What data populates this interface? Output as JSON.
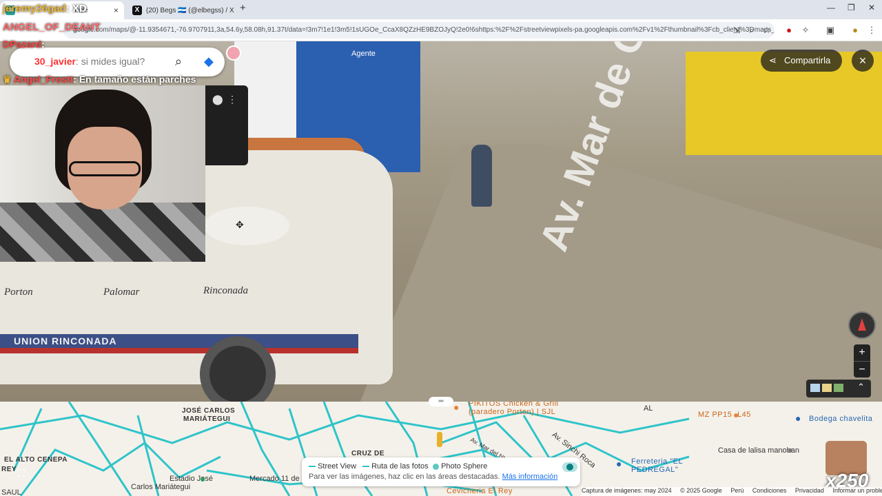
{
  "browser": {
    "tabs": [
      {
        "title": "Inde",
        "favicon": "game-icon"
      },
      {
        "title": "(20) Begs 🇳🇮 (@elbegss) / X",
        "favicon": "x-icon"
      }
    ],
    "new_tab": "+",
    "tab_close": "×",
    "url": "google.com/maps/@-11.9354671,-76.9707911,3a,54.6y,58.08h,91.37t/data=!3m7!1e1!3m5!1sUGOe_CcaX8QZzHE9BZOJyQ!2e0!6shttps:%2F%2Fstreetviewpixels-pa.googleapis.com%2Fv1%2Fthumbnail%3Fcb_client%3Dmaps_sv.tac..."
  },
  "chat": {
    "user1_name": "jeremy26gad",
    "user1_msg": ": XD",
    "user2_name": "ANGEL_OF_DEAHT",
    "user3_name": "DPazard",
    "user3_msg": ":",
    "user4_name": "30_javier",
    "user4_msg": ": si mides igual?",
    "user5_name": "Angel_Frostt",
    "user5_msg": ": En tamaño están parches"
  },
  "streetview": {
    "share_label": "Compartirla",
    "close_label": "×",
    "street_name": "Av. Mar de Coral",
    "shop_sign": "Agente",
    "van_labels": [
      "Porton",
      "Palomar",
      "Rinconada"
    ],
    "van_side": "UNION RINCONADA",
    "zoom_in": "+",
    "zoom_out": "−",
    "expand": "⌃"
  },
  "map": {
    "labels": [
      {
        "text": "JOSÉ CARLOS",
        "cls": ""
      },
      {
        "text": "MARIÁTEGUI",
        "cls": ""
      },
      {
        "text": "EL ALTO CENEPA",
        "cls": ""
      },
      {
        "text": "REY",
        "cls": ""
      },
      {
        "text": "CRUZ DE",
        "cls": ""
      },
      {
        "text": "AL",
        "cls": "n"
      },
      {
        "text": "Estadio José",
        "cls": "n"
      },
      {
        "text": "Carlos Mariátegui",
        "cls": "n"
      },
      {
        "text": "Mercado 11 de",
        "cls": "n"
      },
      {
        "text": "Casa de lalisa manoban",
        "cls": "n"
      },
      {
        "text": "Av. Sinchi Roca",
        "cls": "n"
      },
      {
        "text": "Av. Mar del Nte Este",
        "cls": "n"
      },
      {
        "text": "SAUL",
        "cls": "n"
      }
    ],
    "pois": [
      {
        "text": "PIKITOS Chicken & Grill",
        "cls": "o"
      },
      {
        "text": "(paradero Porton) | SJL",
        "cls": "o"
      },
      {
        "text": "MZ PP15 -L45",
        "cls": "o"
      },
      {
        "text": "Bodega chavelita",
        "cls": "b"
      },
      {
        "text": "Ferreteria \"EL",
        "cls": "b"
      },
      {
        "text": "PEDREGAL\"",
        "cls": "b"
      },
      {
        "text": "Cevicheria El Rey",
        "cls": "o"
      }
    ],
    "legend": {
      "street_view": "Street View",
      "photo_route": "Ruta de las fotos",
      "photo_sphere": "Photo Sphere",
      "note": "Para ver las imágenes, haz clic en las áreas destacadas.",
      "more": "Más información"
    },
    "footer": [
      "Captura de imágenes: may 2024",
      "© 2025 Google",
      "Perú",
      "Condiciones",
      "Privacidad",
      "Informar un problema"
    ],
    "emote_count": "x250"
  },
  "colors": {
    "route": "#2ec4c9",
    "chat_red": "#ff4040",
    "chat_gold": "#e9b531",
    "chat_white": "#ffffff"
  }
}
